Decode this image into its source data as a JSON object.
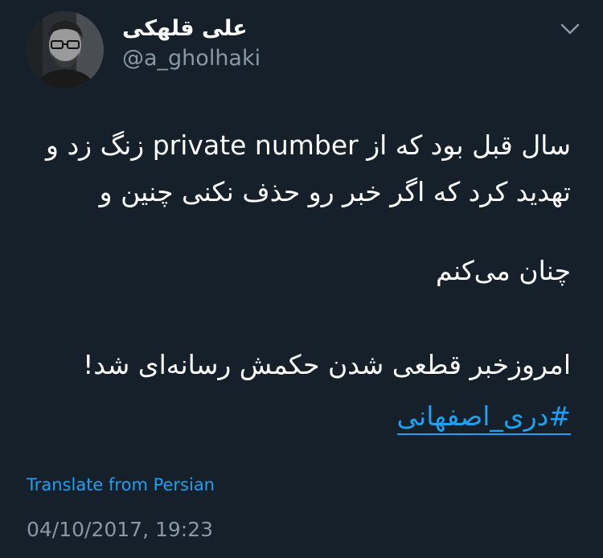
{
  "tweet": {
    "display_name": "علی قلهکی",
    "handle": "@a_gholhaki",
    "menu_icon": "chevron-down-icon",
    "body_lines": [
      "سال قبل بود که از private number زنگ زد و",
      "تهدید کرد که اگر خبر رو حذف نکنی چنین و",
      "چنان می‌کنم",
      "امروزخبر قطعی شدن حکمش رسانه‌ای شد!"
    ],
    "hashtag": "#دری_اصفهانی",
    "translate_label": "Translate from Persian",
    "timestamp": "04/10/2017, 19:23"
  },
  "colors": {
    "background": "#15202b",
    "primary_text": "#ffffff",
    "secondary_text": "#8899a6",
    "accent": "#1da1f2"
  }
}
